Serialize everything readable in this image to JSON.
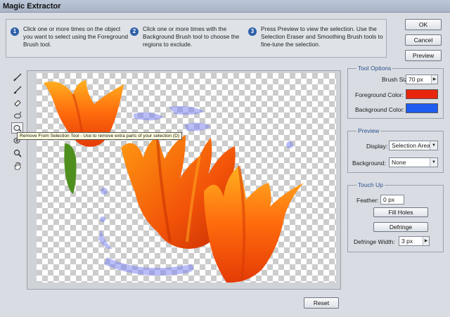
{
  "window": {
    "title": "Magic Extractor"
  },
  "instructions": [
    {
      "num": "1",
      "text": "Click one or more times on the object you want to select using the Foreground Brush tool."
    },
    {
      "num": "2",
      "text": "Click one or more times with the Background Brush tool to choose the regions to exclude."
    },
    {
      "num": "3",
      "text": "Press Preview to view the selection. Use the Selection Eraser and Smoothing Brush tools to fine-tune the selection."
    }
  ],
  "buttons": {
    "ok": "OK",
    "cancel": "Cancel",
    "preview": "Preview",
    "reset": "Reset"
  },
  "tooltip": "Remove From Selection Tool - Use to remove extra parts of your selection (D)",
  "tool_options": {
    "title": "Tool Options",
    "brush_size_label": "Brush Size:",
    "brush_size_value": "70 px",
    "foreground_label": "Foreground Color:",
    "foreground_color": "#e8260e",
    "background_label": "Background Color:",
    "background_color": "#1f5cf0"
  },
  "preview": {
    "title": "Preview",
    "display_label": "Display:",
    "display_value": "Selection Area",
    "background_label": "Background:",
    "background_value": "None"
  },
  "touch_up": {
    "title": "Touch Up",
    "feather_label": "Feather:",
    "feather_value": "0 px",
    "fill_holes": "Fill Holes",
    "defringe": "Defringe",
    "defringe_width_label": "Defringe Width:",
    "defringe_width_value": "3 px"
  },
  "tools": [
    "foreground-brush-icon",
    "background-brush-icon",
    "selection-eraser-icon",
    "smoothing-brush-icon",
    "remove-from-selection-icon",
    "add-to-selection-icon",
    "zoom-icon",
    "hand-icon"
  ]
}
